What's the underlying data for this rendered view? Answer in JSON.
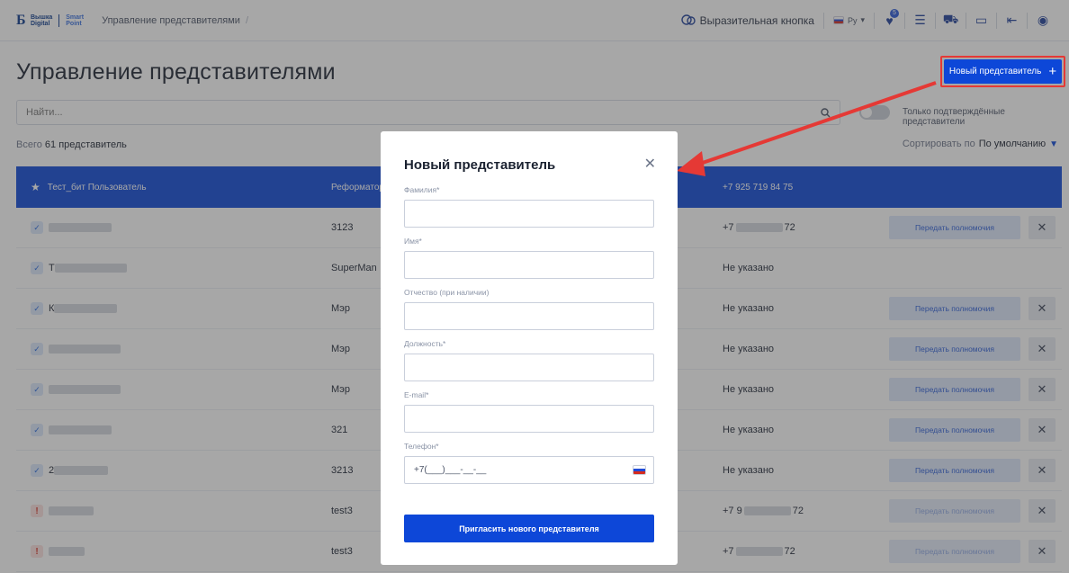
{
  "header": {
    "logo_line1": "Вышка",
    "logo_line2": "Digital",
    "logo_line3": "Smart",
    "logo_line4": "Point",
    "breadcrumb": "Управление представителями",
    "breadcrumb_sep": "/",
    "expressive_button": "Выразительная кнопка",
    "lang": "Ру",
    "favorites_badge": "5"
  },
  "page": {
    "title": "Управление представителями",
    "new_button": "Новый представитель",
    "search_placeholder": "Найти...",
    "toggle_label": "Только подтверждённые представители",
    "total_prefix": "Всего",
    "total_value": "61 представитель",
    "sort_label": "Сортировать по",
    "sort_value": "По умолчанию"
  },
  "table": {
    "head": {
      "name": "Тест_бит Пользователь",
      "org": "Реформатор",
      "phone": "+7 925 719 84 75"
    },
    "rows": [
      {
        "status": "ok",
        "initial": "",
        "org": "3123",
        "phone": "+7",
        "phone_tail": "72",
        "action": "Передать полномочия",
        "has_action": true,
        "dim": false
      },
      {
        "status": "ok",
        "initial": "Т",
        "org": "SuperMan",
        "phone": "Не указано",
        "phone_tail": "",
        "action": "",
        "has_action": false,
        "dim": false
      },
      {
        "status": "ok",
        "initial": "К",
        "org": "Мэр",
        "phone": "Не указано",
        "phone_tail": "",
        "action": "Передать полномочия",
        "has_action": true,
        "dim": false
      },
      {
        "status": "ok",
        "initial": "",
        "org": "Мэр",
        "phone": "Не указано",
        "phone_tail": "",
        "action": "Передать полномочия",
        "has_action": true,
        "dim": false
      },
      {
        "status": "ok",
        "initial": "",
        "org": "Мэр",
        "phone": "Не указано",
        "phone_tail": "",
        "action": "Передать полномочия",
        "has_action": true,
        "dim": false
      },
      {
        "status": "ok",
        "initial": "",
        "org": "321",
        "phone": "Не указано",
        "phone_tail": "",
        "action": "Передать полномочия",
        "has_action": true,
        "dim": false
      },
      {
        "status": "ok",
        "initial": "2",
        "org": "3213",
        "phone": "Не указано",
        "phone_tail": "",
        "action": "Передать полномочия",
        "has_action": true,
        "dim": false
      },
      {
        "status": "warn",
        "initial": "",
        "org": "test3",
        "phone": "+7 9",
        "phone_tail": "72",
        "action": "Передать полномочия",
        "has_action": true,
        "dim": true
      },
      {
        "status": "warn",
        "initial": "",
        "org": "test3",
        "phone": "+7",
        "phone_tail": "72",
        "action": "Передать полномочия",
        "has_action": true,
        "dim": true
      }
    ]
  },
  "modal": {
    "title": "Новый представитель",
    "fields": [
      {
        "label": "Фамилия*",
        "value": ""
      },
      {
        "label": "Имя*",
        "value": ""
      },
      {
        "label": "Отчество (при наличии)",
        "value": ""
      },
      {
        "label": "Должность*",
        "value": ""
      },
      {
        "label": "E-mail*",
        "value": ""
      }
    ],
    "phone_label": "Телефон*",
    "phone_mask": "+7(___)___-__-__",
    "submit": "Пригласить нового представителя"
  },
  "colors": {
    "accent": "#0d47d8",
    "highlight": "#e53935"
  },
  "icons": [
    "search-icon",
    "star-icon",
    "check-icon",
    "warning-icon",
    "close-icon",
    "plus-icon",
    "chevron-down-icon"
  ]
}
